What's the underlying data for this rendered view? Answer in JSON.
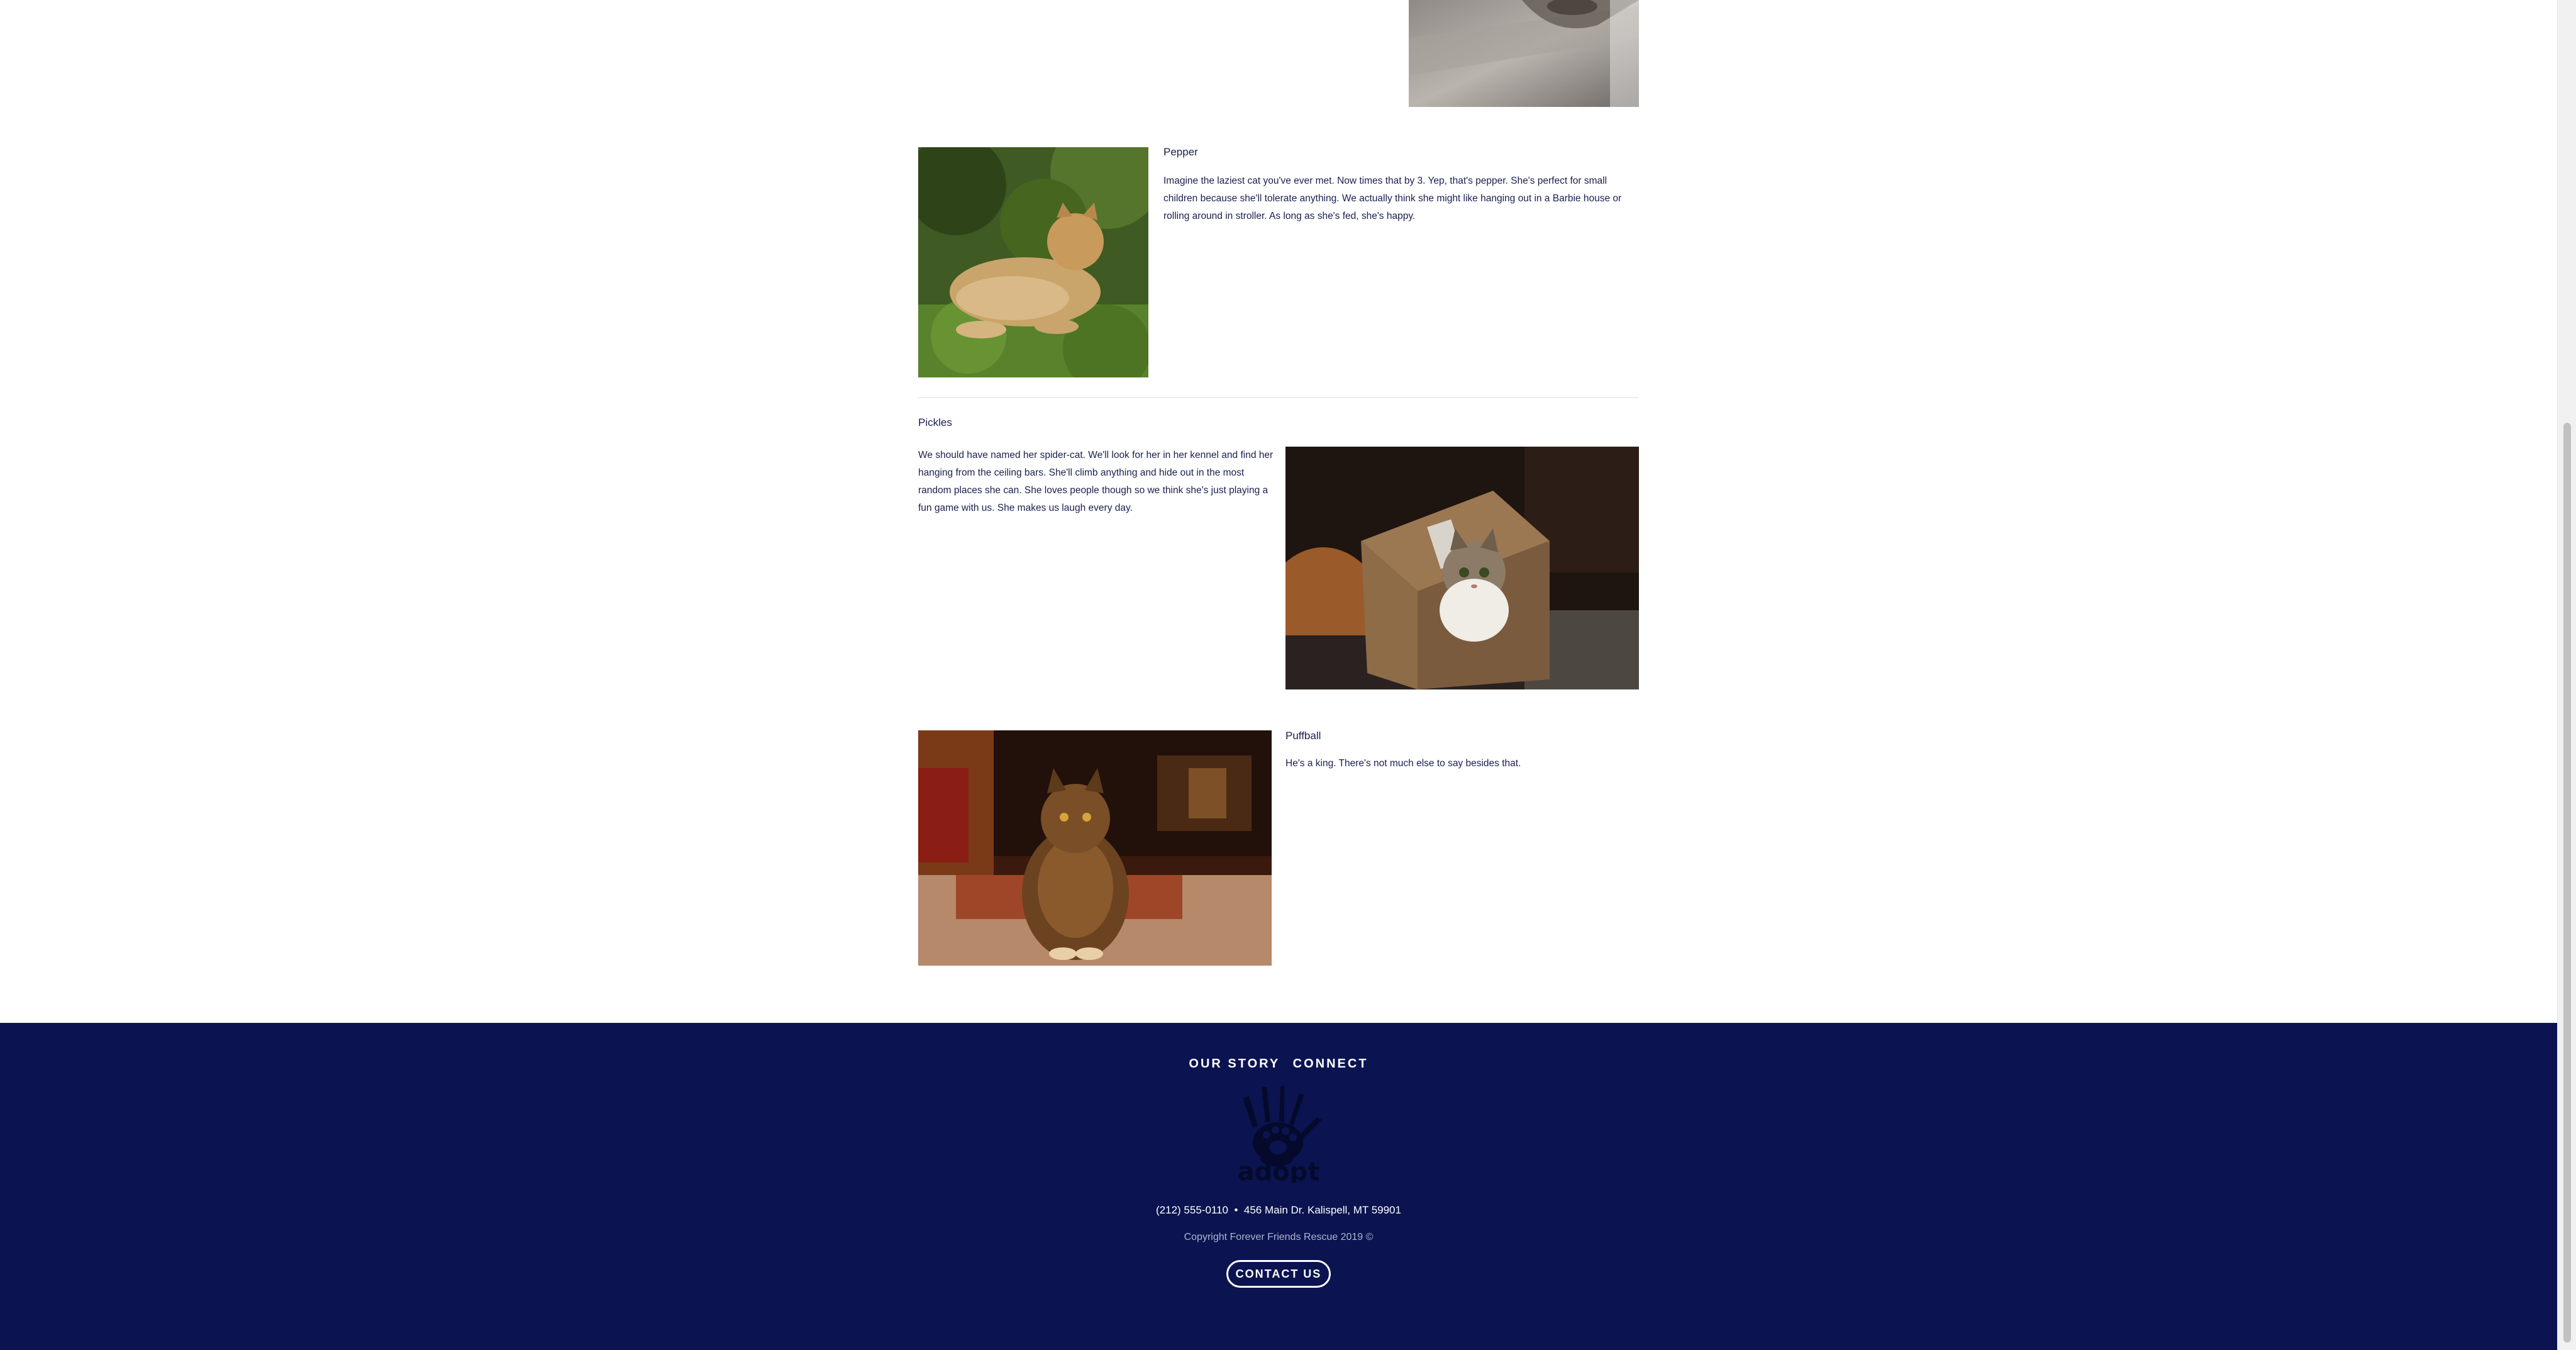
{
  "pets": [
    {
      "name": "Pepper",
      "description": "Imagine the laziest cat you've ever met. Now times that by 3. Yep, that's pepper. She's perfect for small children because she'll tolerate anything. We actually think she might like hanging out in a Barbie house or rolling around in stroller. As long as she's fed, she's happy."
    },
    {
      "name": "Pickles",
      "description": "We should have named her spider-cat. We'll look for her in her kennel and find her hanging from the ceiling bars. She'll climb anything and hide out in the most random places she can. She loves people though so we think she's just playing a fun game with us. She makes us laugh every day."
    },
    {
      "name": "Puffball",
      "description": "He's a king. There's not much else to say besides that."
    }
  ],
  "footer": {
    "nav": [
      "OUR STORY",
      "CONNECT"
    ],
    "logo_text": "adopt",
    "phone": "(212) 555-0110",
    "separator": "•",
    "address": "456 Main Dr. Kalispell, MT 59901",
    "copyright": "Copyright Forever Friends Rescue 2019 ©",
    "contact_button": "CONTACT US"
  },
  "colors": {
    "footer_bg": "#0b1450",
    "text": "#1a1f4f",
    "white": "#ffffff"
  },
  "icons": {
    "logo": "hand-paw-logo-icon"
  }
}
